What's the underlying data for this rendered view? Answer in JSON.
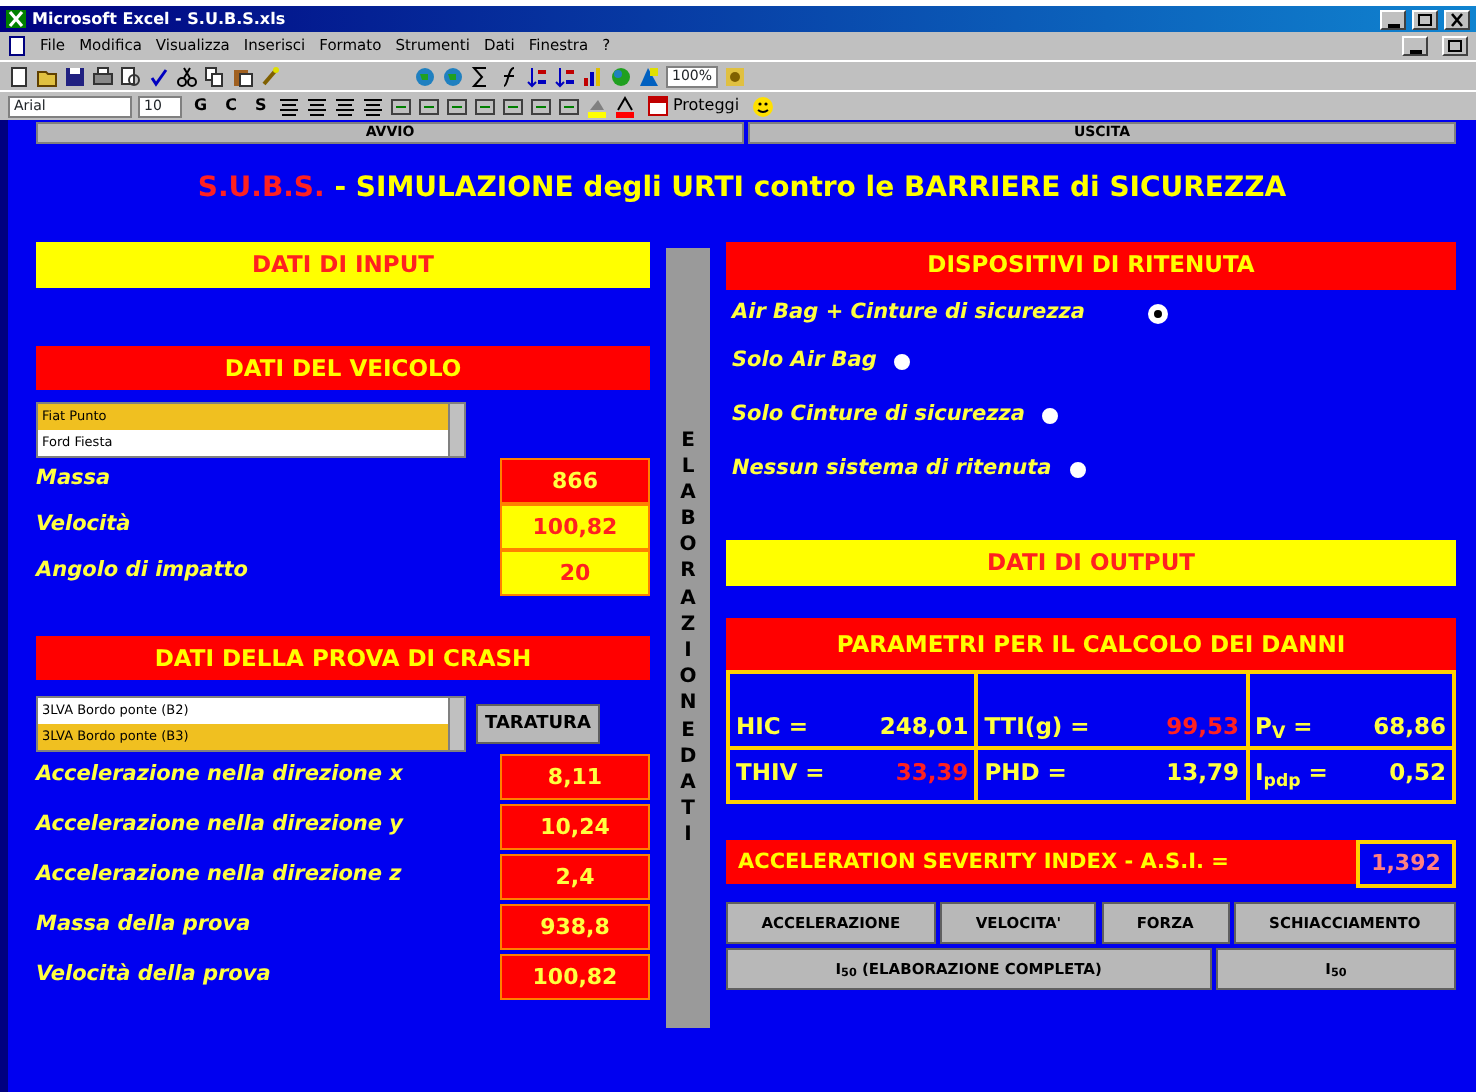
{
  "window": {
    "title": "Microsoft Excel - S.U.B.S.xls"
  },
  "menu": [
    "File",
    "Modifica",
    "Visualizza",
    "Inserisci",
    "Formato",
    "Strumenti",
    "Dati",
    "Finestra",
    "?"
  ],
  "toolbar": {
    "zoom": "100%"
  },
  "format_toolbar": {
    "font": "Arial",
    "size": "10",
    "style_buttons": [
      "G",
      "C",
      "S"
    ],
    "extra_button": "Proteggi"
  },
  "nav_buttons": [
    "AVVIO",
    "USCITA"
  ],
  "app_title": {
    "acronym": "S.U.B.S.",
    "rest": " - SIMULAZIONE degli URTI contro le BARRIERE di SICUREZZA"
  },
  "input": {
    "title": "DATI DI INPUT",
    "vehicle": {
      "title": "DATI DEL VEICOLO",
      "list": [
        {
          "label": "Fiat Punto",
          "selected": true
        },
        {
          "label": "Ford Fiesta",
          "selected": false
        }
      ],
      "rows": [
        {
          "label": "Massa",
          "value": "866",
          "color": "#ff0000"
        },
        {
          "label": "Velocità",
          "value": "100,82",
          "color": "#ffff00"
        },
        {
          "label": "Angolo di impatto",
          "value": "20",
          "color": "#ffff00"
        }
      ]
    },
    "crash": {
      "title": "DATI DELLA PROVA DI CRASH",
      "list": [
        {
          "label": "3LVA Bordo ponte (B2)",
          "selected": false
        },
        {
          "label": "3LVA Bordo ponte (B3)",
          "selected": true
        }
      ],
      "button": "TARATURA",
      "rows": [
        {
          "label": "Accelerazione nella direzione x",
          "value": "8,11",
          "color": "#ff0000"
        },
        {
          "label": "Accelerazione nella direzione y",
          "value": "10,24",
          "color": "#ff0000"
        },
        {
          "label": "Accelerazione nella direzione z",
          "value": "2,4",
          "color": "#ff0000"
        },
        {
          "label": "Massa della prova",
          "value": "938,8",
          "color": "#ff0000"
        },
        {
          "label": "Velocità della prova",
          "value": "100,82",
          "color": "#ff0000"
        }
      ]
    }
  },
  "separator": "ELABORAZIONE DATI",
  "restraints": {
    "title": "DISPOSITIVI DI RITENUTA",
    "options": [
      {
        "label": "Air Bag + Cinture di sicurezza",
        "selected": true
      },
      {
        "label": "Solo Air Bag",
        "selected": false
      },
      {
        "label": "Solo Cinture di sicurezza",
        "selected": false
      },
      {
        "label": "Nessun sistema di ritenuta",
        "selected": false
      }
    ]
  },
  "output": {
    "title": "DATI DI OUTPUT",
    "params_title": "PARAMETRI PER IL CALCOLO DEI DANNI",
    "params": [
      [
        {
          "label": "HIC =",
          "value": "248,01",
          "alert": false
        },
        {
          "label": "TTI(g) =",
          "value": "99,53",
          "alert": true
        },
        {
          "label": "P$_{V}$ =",
          "value": "68,86",
          "alert": false
        }
      ],
      [
        {
          "label": "THIV =",
          "value": "33,39",
          "alert": true
        },
        {
          "label": "PHD =",
          "value": "13,79",
          "alert": false
        },
        {
          "label": "I$_{pdp}$ =",
          "value": "0,52",
          "alert": false
        }
      ]
    ],
    "asi": {
      "label": "ACCELERATION SEVERITY INDEX - A.S.I. =",
      "value": "1,392"
    },
    "buttons": [
      [
        "ACCELERAZIONE",
        "VELOCITA'",
        "FORZA",
        "SCHIACCIAMENTO"
      ],
      [
        "I$_{50}$ (ELABORAZIONE COMPLETA)",
        "I$_{50}$"
      ]
    ]
  }
}
